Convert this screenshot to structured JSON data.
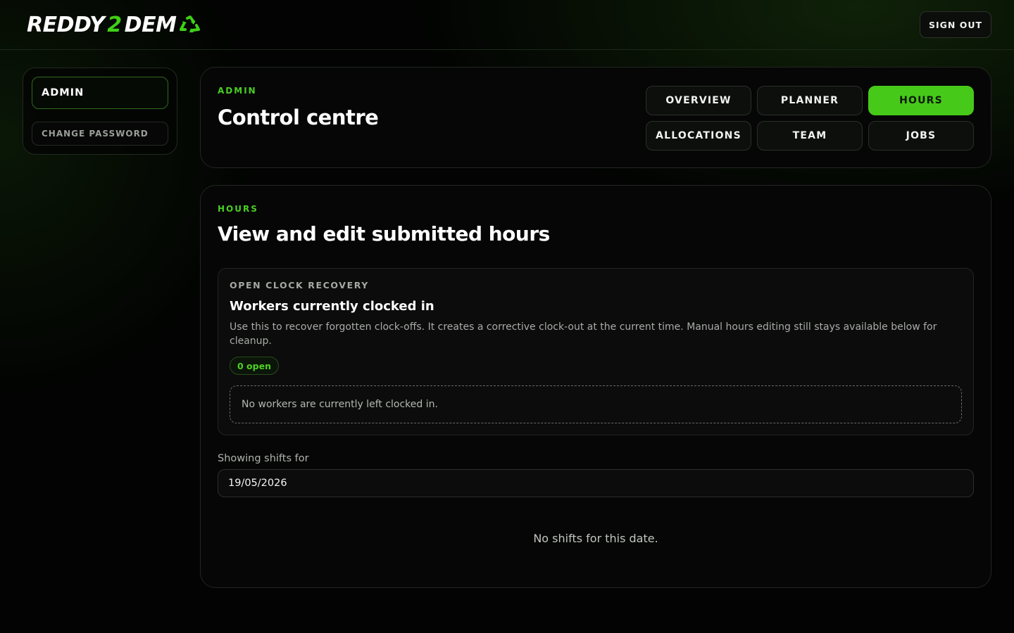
{
  "header": {
    "logo": {
      "part1": "REDDY",
      "part2": "2",
      "part3": "DEM",
      "icon": "recycle-icon"
    },
    "signout_label": "SIGN OUT"
  },
  "sidebar": {
    "items": [
      {
        "label": "ADMIN",
        "active": true
      },
      {
        "label": "CHANGE PASSWORD",
        "active": false
      }
    ]
  },
  "control": {
    "eyebrow": "ADMIN",
    "title": "Control centre",
    "nav": [
      {
        "label": "OVERVIEW",
        "active": false
      },
      {
        "label": "PLANNER",
        "active": false
      },
      {
        "label": "HOURS",
        "active": true
      },
      {
        "label": "ALLOCATIONS",
        "active": false
      },
      {
        "label": "TEAM",
        "active": false
      },
      {
        "label": "JOBS",
        "active": false
      }
    ]
  },
  "hours": {
    "eyebrow": "HOURS",
    "title": "View and edit submitted hours",
    "recovery": {
      "eyebrow": "OPEN CLOCK RECOVERY",
      "title": "Workers currently clocked in",
      "description": "Use this to recover forgotten clock-offs. It creates a corrective clock-out at the current time. Manual hours editing still stays available below for cleanup.",
      "badge": "0 open",
      "empty_message": "No workers are currently left clocked in."
    },
    "date_label": "Showing shifts for",
    "date_value": "19/05/2026",
    "no_shifts_message": "No shifts for this date."
  },
  "colors": {
    "accent": "#47c91a",
    "background": "#020302"
  }
}
